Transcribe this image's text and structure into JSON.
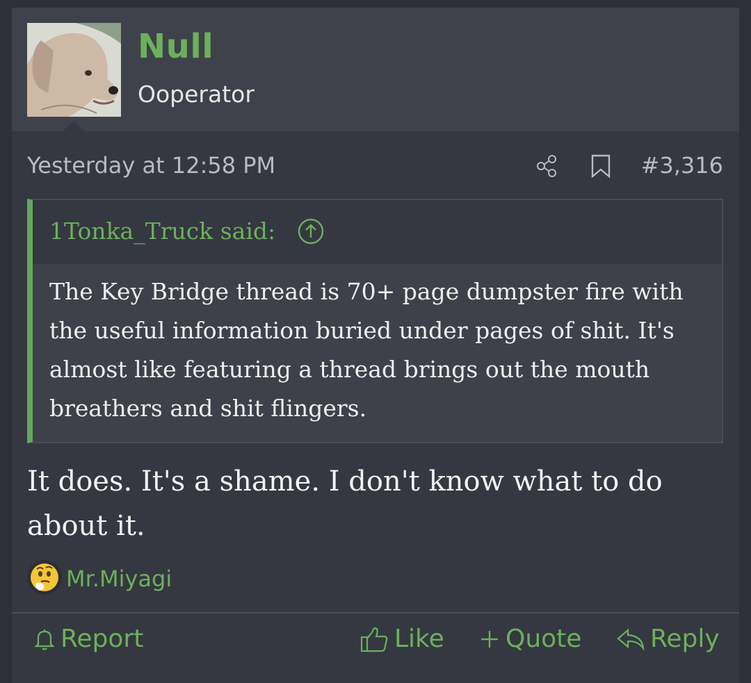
{
  "post": {
    "author": "Null",
    "author_title": "Ooperator",
    "timestamp": "Yesterday at 12:58 PM",
    "post_number": "#3,316",
    "quote": {
      "author_line": "1Tonka_Truck said:",
      "text": "The Key Bridge thread is 70+ page dumpster fire with the useful information buried under pages of shit. It's almost like featuring a thread brings out the mouth breathers and shit flingers."
    },
    "message": "It does. It's a shame. I don't know what to do about it.",
    "reaction": {
      "emoji": "thinking-face",
      "user": "Mr.Miyagi"
    },
    "actions": {
      "report": "Report",
      "like": "Like",
      "quote": "Quote",
      "reply": "Reply"
    }
  },
  "colors": {
    "accent": "#6cb05c",
    "background": "#353840",
    "header": "#3f424a"
  }
}
